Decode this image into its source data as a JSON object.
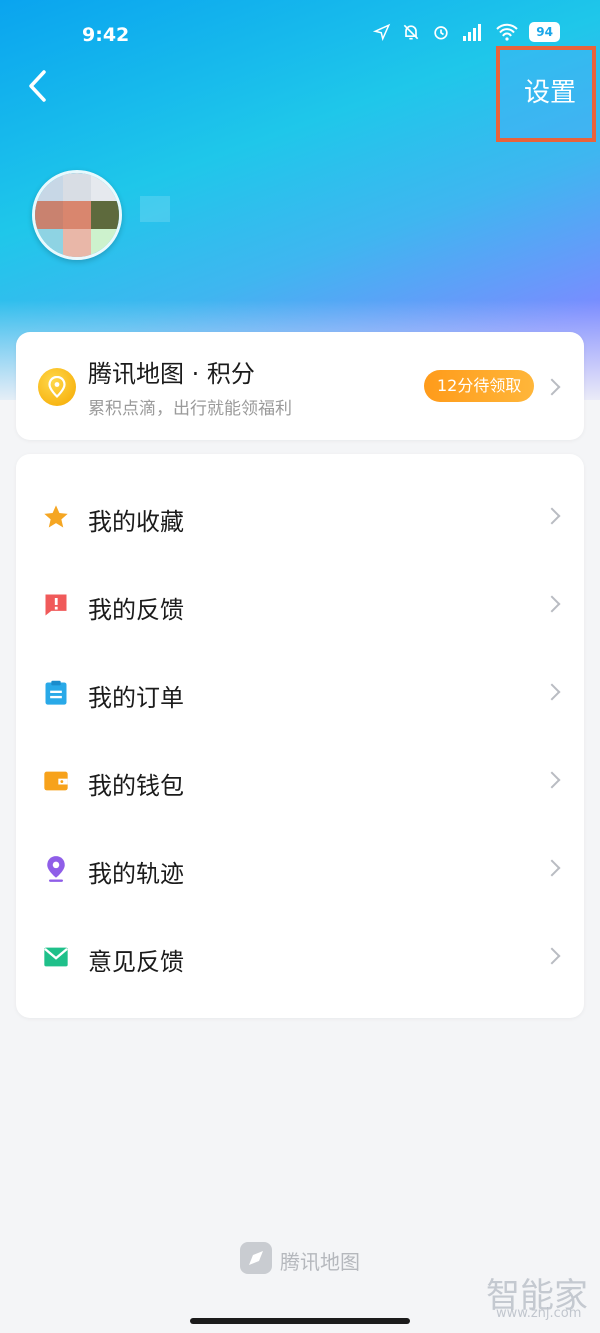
{
  "status_bar": {
    "time": "9:42",
    "battery": "94",
    "icons": [
      "location-arrow-icon",
      "mute-bell-icon",
      "alarm-icon",
      "hd-signal-icon",
      "wifi-icon",
      "battery-icon"
    ]
  },
  "header": {
    "back_icon": "chevron-left-icon",
    "settings_label": "设置",
    "highlight_color": "#e8633b"
  },
  "points": {
    "title": "腾讯地图 · 积分",
    "subtitle": "累积点滴，出行就能领福利",
    "badge": "12分待领取",
    "icon": "coin-location-icon"
  },
  "menu": {
    "items": [
      {
        "label": "我的收藏",
        "icon": "star-icon",
        "color": "#f5a623"
      },
      {
        "label": "我的反馈",
        "icon": "alert-flag-icon",
        "color": "#f05a5a"
      },
      {
        "label": "我的订单",
        "icon": "clipboard-icon",
        "color": "#29a9e8"
      },
      {
        "label": "我的钱包",
        "icon": "wallet-icon",
        "color": "#f7a21b"
      },
      {
        "label": "我的轨迹",
        "icon": "location-pin-icon",
        "color": "#8f5ee8"
      },
      {
        "label": "意见反馈",
        "icon": "mail-icon",
        "color": "#1fc08a"
      }
    ]
  },
  "footer": {
    "brand": "腾讯地图",
    "watermark": "智能家",
    "watermark_url": "www.znj.com"
  }
}
